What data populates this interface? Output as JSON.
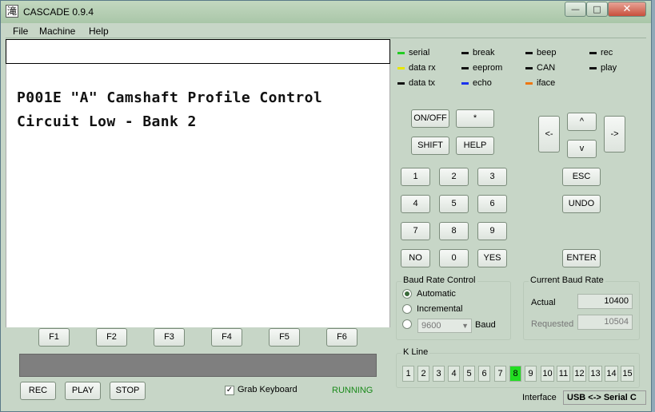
{
  "window": {
    "title": "CASCADE 0.9.4",
    "app_icon": "滝",
    "minimize": "—",
    "maximize": "□",
    "close": "✕"
  },
  "menu": [
    "File",
    "Machine",
    "Help"
  ],
  "command_input": {
    "value": ""
  },
  "display": {
    "lines": [
      "P001E \"A\" Camshaft Profile Control",
      "Circuit Low - Bank 2"
    ]
  },
  "function_keys": [
    "F1",
    "F2",
    "F3",
    "F4",
    "F5",
    "F6"
  ],
  "transport": {
    "rec": "REC",
    "play": "PLAY",
    "stop": "STOP"
  },
  "grab_keyboard": {
    "label": "Grab Keyboard",
    "checked": true,
    "check_glyph": "✓"
  },
  "status_text": "RUNNING",
  "indicators": [
    {
      "label": "serial",
      "color": "#22cc22"
    },
    {
      "label": "break",
      "color": "#111111"
    },
    {
      "label": "beep",
      "color": "#111111"
    },
    {
      "label": "rec",
      "color": "#111111"
    },
    {
      "label": "data rx",
      "color": "#e6e600"
    },
    {
      "label": "eeprom",
      "color": "#111111"
    },
    {
      "label": "CAN",
      "color": "#111111"
    },
    {
      "label": "play",
      "color": "#111111"
    },
    {
      "label": "data tx",
      "color": "#111111"
    },
    {
      "label": "echo",
      "color": "#1a33ee"
    },
    {
      "label": "iface",
      "color": "#ee7711"
    }
  ],
  "keypad": {
    "on_off": "ON/OFF",
    "star": "*",
    "shift": "SHIFT",
    "help": "HELP",
    "left": "<-",
    "up": "^",
    "down": "v",
    "right": "->",
    "digits": [
      "1",
      "2",
      "3",
      "4",
      "5",
      "6",
      "7",
      "8",
      "9",
      "0"
    ],
    "no": "NO",
    "yes": "YES",
    "esc": "ESC",
    "undo": "UNDO",
    "enter": "ENTER"
  },
  "baud_control": {
    "title": "Baud Rate Control",
    "automatic": "Automatic",
    "incremental": "Incremental",
    "baud_value": "9600",
    "baud_suffix": "Baud",
    "selected": "Automatic"
  },
  "current_baud": {
    "title": "Current Baud Rate",
    "actual_label": "Actual",
    "actual_value": "10400",
    "requested_label": "Requested",
    "requested_value": "10504"
  },
  "k_line": {
    "title": "K Line",
    "cells": [
      "1",
      "2",
      "3",
      "4",
      "5",
      "6",
      "7",
      "8",
      "9",
      "10",
      "11",
      "12",
      "13",
      "14",
      "15"
    ],
    "active": "8"
  },
  "interface": {
    "label": "Interface",
    "value": "USB <-> Serial C"
  }
}
